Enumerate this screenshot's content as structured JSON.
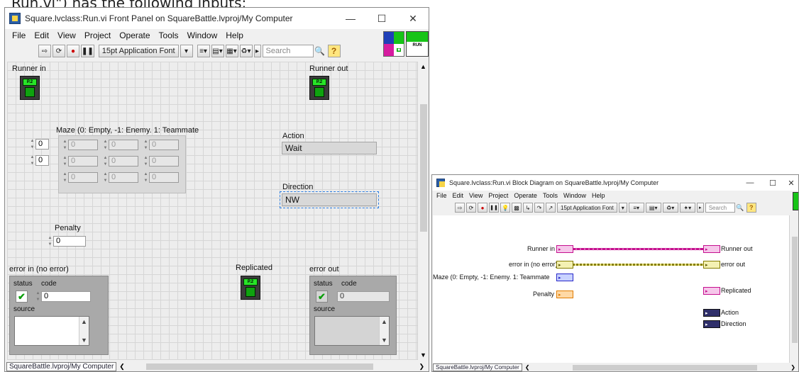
{
  "doc_fragment": "Run.vi\") has the following inputs:",
  "front_panel": {
    "title": "Square.lvclass:Run.vi Front Panel on SquareBattle.lvproj/My Computer",
    "menu": [
      "File",
      "Edit",
      "View",
      "Project",
      "Operate",
      "Tools",
      "Window",
      "Help"
    ],
    "toolbar": {
      "font_label": "15pt Application Font",
      "search_placeholder": "Search"
    },
    "run_label": "RUN",
    "controls": {
      "runner_in": "Runner in",
      "runner_out": "Runner out",
      "maze_label": "Maze (0: Empty, -1: Enemy. 1: Teammate",
      "maze_index_row": "0",
      "maze_index_col": "0",
      "maze_cells": [
        "0",
        "0",
        "0",
        "0",
        "0",
        "0",
        "0",
        "0",
        "0"
      ],
      "action_label": "Action",
      "action_value": "Wait",
      "direction_label": "Direction",
      "direction_value": "NW",
      "penalty_label": "Penalty",
      "penalty_value": "0",
      "replicated_label": "Replicated",
      "error_in_label": "error in (no error)",
      "error_in_status": "status",
      "error_in_code": "code",
      "error_in_code_value": "0",
      "error_in_source": "source",
      "error_out_label": "error out",
      "error_out_status": "status",
      "error_out_code": "code",
      "error_out_code_value": "0",
      "error_out_source": "source"
    },
    "status_tab": "SquareBattle.lvproj/My Computer"
  },
  "block_diagram": {
    "title": "Square.lvclass:Run.vi Block Diagram on SquareBattle.lvproj/My Computer",
    "menu": [
      "File",
      "Edit",
      "View",
      "Project",
      "Operate",
      "Tools",
      "Window",
      "Help"
    ],
    "toolbar": {
      "font_label": "15pt Application Font",
      "search_placeholder": "Search"
    },
    "terminals": {
      "runner_in": "Runner in",
      "runner_out": "Runner out",
      "error_in": "error in (no error)",
      "error_out": "error out",
      "maze": "Maze (0: Empty, -1: Enemy. 1: Teammate",
      "penalty": "Penalty",
      "replicated": "Replicated",
      "action": "Action",
      "direction": "Direction"
    },
    "status_tab": "SquareBattle.lvproj/My Computer"
  },
  "colors": {
    "class_wire": "#c5108f",
    "error_wire": "#857d00",
    "run_green": "#17c417"
  }
}
